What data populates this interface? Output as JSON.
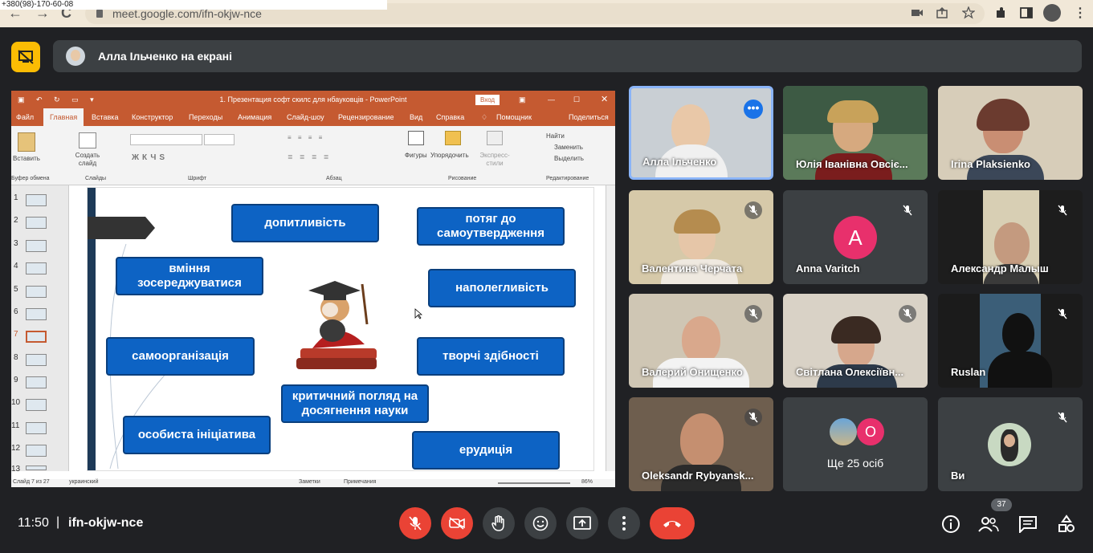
{
  "browser": {
    "phone_overlay": "+380(98)-170-60-08",
    "url": "meet.google.com/ifn-okjw-nce",
    "nav_back": "←",
    "nav_forward": "→",
    "nav_reload": "C"
  },
  "meet": {
    "presenting_text": "Алла Ільченко на екрані"
  },
  "powerpoint": {
    "window_title": "1. Презентация софт скилс для нбауковців  -  PowerPoint",
    "signin_label": "Вход",
    "tabs": [
      "Файл",
      "Главная",
      "Вставка",
      "Конструктор",
      "Переходы",
      "Анимация",
      "Слайд-шоу",
      "Рецензирование",
      "Вид",
      "Справка",
      "Помощник",
      "Поделиться"
    ],
    "ribbon_groups": [
      "Буфер обмена",
      "Слайды",
      "Шрифт",
      "Абзац",
      "Рисование",
      "Редактирование"
    ],
    "ribbon_buttons": {
      "paste": "Вставить",
      "new_slide": "Создать слайд",
      "shapes": "Фигуры",
      "arrange": "Упорядочить",
      "express": "Экспресс-стили",
      "find": "Найти",
      "replace": "Заменить",
      "select": "Выделить"
    },
    "slide_numbers": [
      "1",
      "2",
      "3",
      "4",
      "5",
      "6",
      "7",
      "8",
      "9",
      "10",
      "11",
      "12",
      "13"
    ],
    "active_slide": 7,
    "status": {
      "slide_info": "Слайд 7 из 27",
      "language": "украинский",
      "notes": "Заметки",
      "comments": "Примечания",
      "zoom": "86%"
    }
  },
  "slide": {
    "boxes": [
      "допитливість",
      "потяг до самоутвердження",
      "вміння зосереджуватися",
      "наполегливість",
      "самоорганізація",
      "творчі здібності",
      "критичний погляд на досягнення науки",
      "особиста ініціатива",
      "ерудиція"
    ]
  },
  "participants": [
    {
      "name": "Алла Ільченко",
      "muted": false,
      "pinned": true
    },
    {
      "name": "Юлія Іванівна Овсіє...",
      "muted": false
    },
    {
      "name": "Irina Plaksienko",
      "muted": false
    },
    {
      "name": "Валентина Черчата",
      "muted": true
    },
    {
      "name": "Anna Varitch",
      "muted": true,
      "avatar_letter": "A"
    },
    {
      "name": "Александр Малыш",
      "muted": true
    },
    {
      "name": "Валерий Онищенко",
      "muted": true
    },
    {
      "name": "Світлана Олексіївн...",
      "muted": true
    },
    {
      "name": "Ruslan",
      "muted": true
    },
    {
      "name": "Oleksandr Rybyansk...",
      "muted": true
    },
    {
      "name": "Ще 25 осіб",
      "avatar_letter": "O"
    },
    {
      "name": "Ви",
      "muted": true
    }
  ],
  "footer": {
    "time": "11:50",
    "separator": "|",
    "meeting_code": "ifn-okjw-nce",
    "participants_count": "37"
  },
  "colors": {
    "accent_red": "#ea4335",
    "presenting_yellow": "#fbbc04",
    "ppt_orange": "#c55a31",
    "slide_box_blue": "#0d63c4"
  }
}
